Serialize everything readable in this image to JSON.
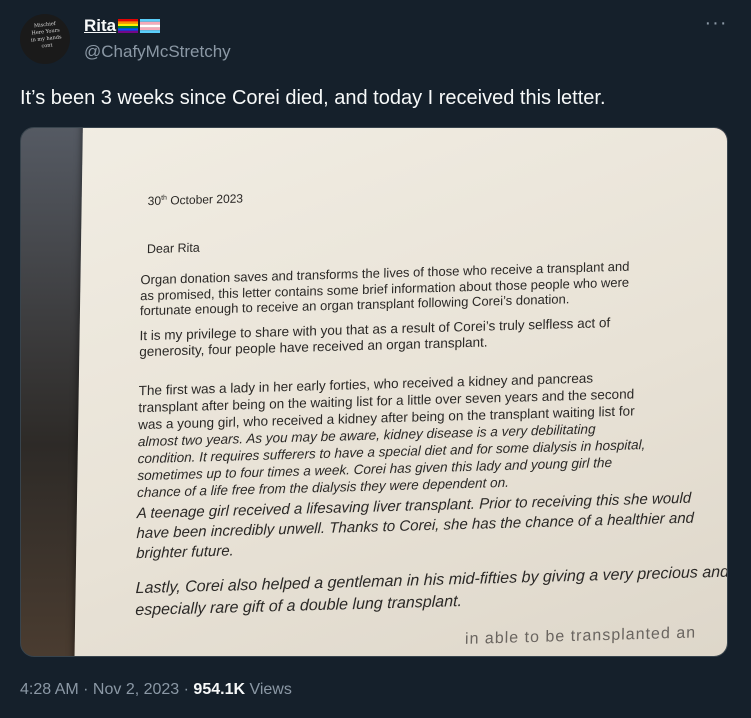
{
  "user": {
    "name": "Rita",
    "handle": "@ChafyMcStretchy",
    "avatar_text": [
      "Mischief",
      "Here Yours",
      "in my hands",
      "cont"
    ],
    "flags": [
      "rainbow-pride-flag-icon",
      "transgender-flag-icon"
    ]
  },
  "menu_icon": "more-horizontal-icon",
  "tweet": {
    "text": "It’s been 3 weeks since Corei died, and today I received this letter."
  },
  "letter": {
    "date": "30",
    "date_suffix": "th",
    "date_rest": " October 2023",
    "greeting": "Dear Rita",
    "p1": [
      "Organ donation saves and transforms the lives of those who receive a transplant and",
      "as promised, this letter contains some brief information about those people who were",
      "fortunate enough to receive an organ transplant following Corei’s donation."
    ],
    "p2": [
      "It is my privilege to share with you that as a result of Corei’s truly selfless act of",
      "generosity, four people have received an organ transplant."
    ],
    "p3": [
      "The first was a lady in her early forties, who received a kidney and pancreas",
      "transplant after being on the waiting list for a little over seven years and the second",
      "was a young girl, who received a kidney after being on the transplant waiting list for",
      "almost two years. As you may be aware, kidney disease is a very debilitating",
      "condition. It requires sufferers to have a special diet and for some dialysis in hospital,",
      "sometimes up to four times a week. Corei has given this lady and young girl the",
      "chance of a life free from the dialysis they were dependent on."
    ],
    "p4": [
      "A teenage girl received a lifesaving liver transplant. Prior to receiving this she would",
      "have been incredibly unwell. Thanks to Corei, she has the chance of a healthier and",
      "brighter future."
    ],
    "p5": [
      "Lastly, Corei also helped a gentleman in his mid-fifties by giving a very precious and",
      "especially rare gift of a double lung transplant."
    ],
    "p6": [
      "in          able    to    be    transplanted    an"
    ]
  },
  "meta": {
    "time": "4:28 AM",
    "sep1": " · ",
    "date": "Nov 2, 2023",
    "sep2": " · ",
    "views_count": "954.1K",
    "views_label": " Views"
  }
}
